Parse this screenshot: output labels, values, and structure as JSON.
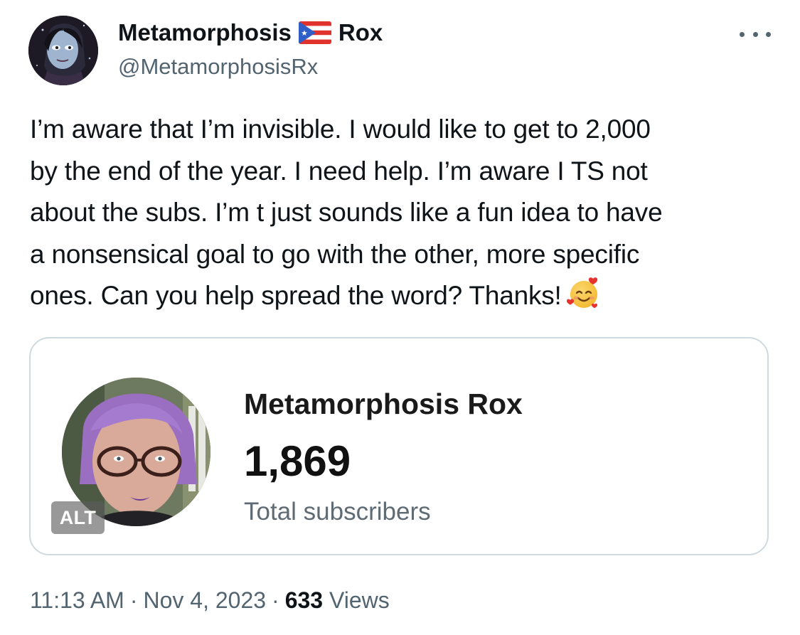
{
  "author": {
    "display_name_part1": "Metamorphosis",
    "flag_icon": "puerto-rico-flag",
    "display_name_part2": "Rox",
    "handle": "@MetamorphosisRx"
  },
  "tweet": {
    "lines": [
      "I’m aware that I’m invisible. I would like to get to 2,000",
      "by the end of the year. I need help. I’m aware I TS not",
      "about the subs. I’m t just sounds like a fun idea to have",
      "a nonsensical goal to go with the other, more specific",
      "ones. Can you help spread the word? Thanks!"
    ],
    "emoji": "smiling-face-with-hearts"
  },
  "card": {
    "name": "Metamorphosis Rox",
    "count": "1,869",
    "label": "Total subscribers",
    "alt_badge": "ALT"
  },
  "meta": {
    "time": "11:13 AM",
    "date": "Nov 4, 2023",
    "separator": "·",
    "views_count": "633",
    "views_label": "Views"
  },
  "colors": {
    "text_primary": "#0f1419",
    "text_secondary": "#536471",
    "card_border": "#cfd9de"
  }
}
